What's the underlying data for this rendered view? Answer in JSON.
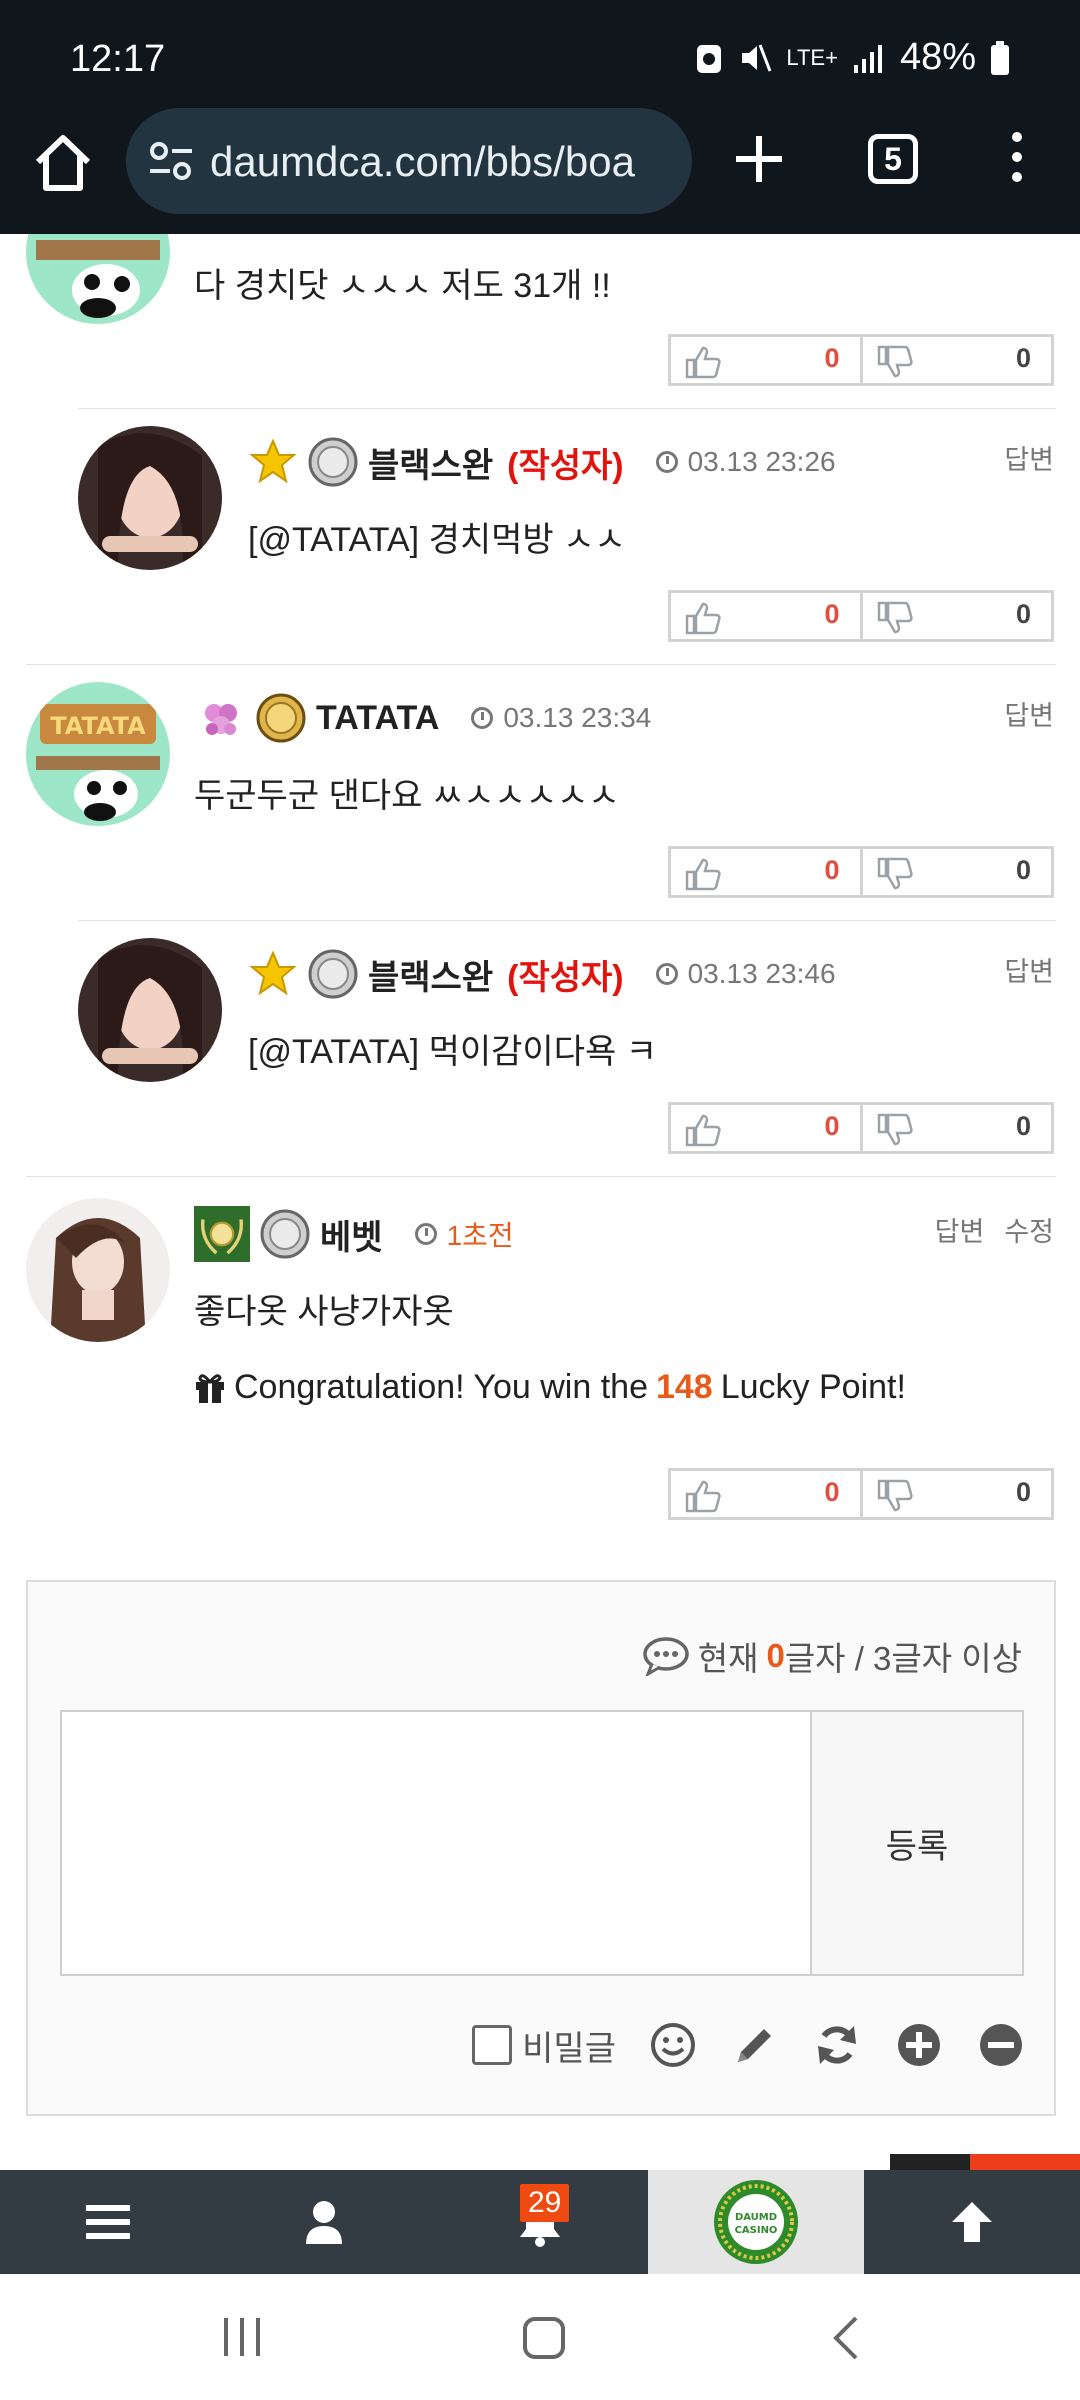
{
  "status": {
    "time": "12:17",
    "network": "LTE+",
    "battery": "48%"
  },
  "browser": {
    "url": "daumdca.com/bbs/boa",
    "tab_count": "5"
  },
  "comments": [
    {
      "text": "다 경치닷 ㅅㅅㅅ 저도 31개 !!",
      "up": "0",
      "down": "0"
    },
    {
      "nick": "블랙스완",
      "author_tag": "(작성자)",
      "date": "03.13 23:26",
      "reply": "답변",
      "text": "[@TATATA] 경치먹방 ㅅㅅ",
      "up": "0",
      "down": "0"
    },
    {
      "nick": "TATATA",
      "date": "03.13 23:34",
      "reply": "답변",
      "text": "두군두군 댄다요 ㅆㅅㅅㅅㅅㅅ",
      "up": "0",
      "down": "0"
    },
    {
      "nick": "블랙스완",
      "author_tag": "(작성자)",
      "date": "03.13 23:46",
      "reply": "답변",
      "text": "[@TATATA] 먹이감이다욕 ㅋ",
      "up": "0",
      "down": "0"
    },
    {
      "nick": "베벳",
      "date": "1초전",
      "reply": "답변",
      "edit": "수정",
      "text": "좋다옷 사냥가자옷",
      "up": "0",
      "down": "0"
    }
  ],
  "lucky": {
    "prefix": "Congratulation! You win the",
    "points": "148",
    "suffix": "Lucky Point!"
  },
  "write": {
    "counter_prefix": "현재",
    "counter_value": "0",
    "counter_suffix": "글자 / 3글자 이상",
    "submit_label": "등록",
    "secret_label": "비밀글"
  },
  "sitenav": {
    "notification_count": "29",
    "logo_text": "DAUMD CASINO"
  },
  "colors": {
    "accent": "#e85a1a",
    "author": "#e2120c",
    "topbar": "#0f161c",
    "sitenav": "#333b43"
  }
}
